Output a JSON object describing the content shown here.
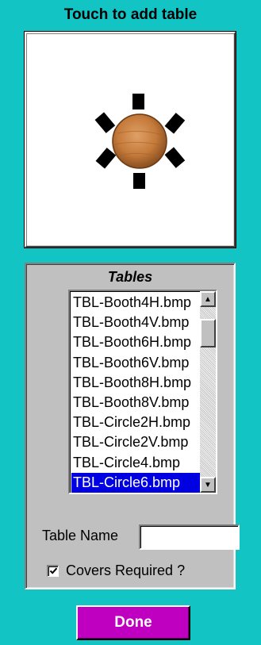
{
  "header": {
    "title": "Touch to add table"
  },
  "preview": {
    "image_icon": "round-table-6-seats-icon",
    "table_color": "#c47a3a"
  },
  "tables_panel": {
    "title": "Tables",
    "items": [
      {
        "label": "TBL-Booth4H.bmp"
      },
      {
        "label": "TBL-Booth4V.bmp"
      },
      {
        "label": "TBL-Booth6H.bmp"
      },
      {
        "label": "TBL-Booth6V.bmp"
      },
      {
        "label": "TBL-Booth8H.bmp"
      },
      {
        "label": "TBL-Booth8V.bmp"
      },
      {
        "label": "TBL-Circle2H.bmp"
      },
      {
        "label": "TBL-Circle2V.bmp"
      },
      {
        "label": "TBL-Circle4.bmp"
      },
      {
        "label": "TBL-Circle6.bmp",
        "selected": true
      }
    ],
    "scroll_up_icon": "triangle-up-icon",
    "scroll_down_icon": "triangle-down-icon",
    "table_name": {
      "label": "Table Name",
      "value": "",
      "placeholder": ""
    },
    "covers_required": {
      "label": "Covers Required ?",
      "checked": true
    }
  },
  "done_button": {
    "label": "Done"
  },
  "colors": {
    "background": "#12c4c4",
    "panel": "#c0c0c0",
    "selection": "#0000e0",
    "done": "#c000c0"
  }
}
